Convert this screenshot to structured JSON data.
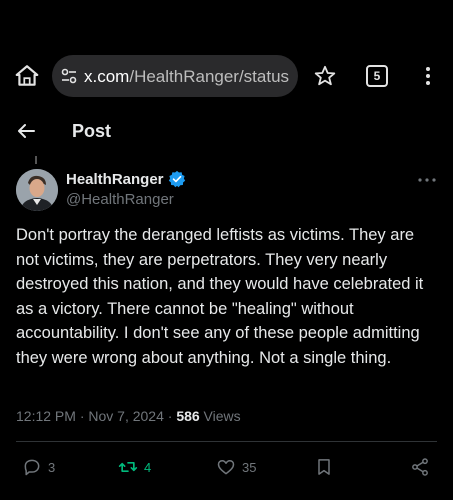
{
  "browser": {
    "url_host": "x.com",
    "url_path": "/HealthRanger/status",
    "tab_count": "5"
  },
  "header": {
    "title": "Post"
  },
  "author": {
    "name": "HealthRanger",
    "handle": "@HealthRanger"
  },
  "tweet": {
    "text": "Don't portray the deranged leftists as victims. They are not victims, they are perpetrators. They very nearly destroyed this nation, and they would have celebrated it as a victory. There cannot be \"healing\" without accountability. I don't see any of these people admitting they were wrong about anything. Not a single thing.",
    "timestamp": "12:12 PM · Nov 7, 2024 · ",
    "views_count": "586",
    "views_label": " Views"
  },
  "actions": {
    "replies": "3",
    "reposts": "4",
    "likes": "35"
  },
  "colors": {
    "background": "#000000",
    "text": "#e7e9ea",
    "secondary": "#71767b",
    "verified": "#1d9bf0",
    "repost_active": "#00ba7c"
  }
}
